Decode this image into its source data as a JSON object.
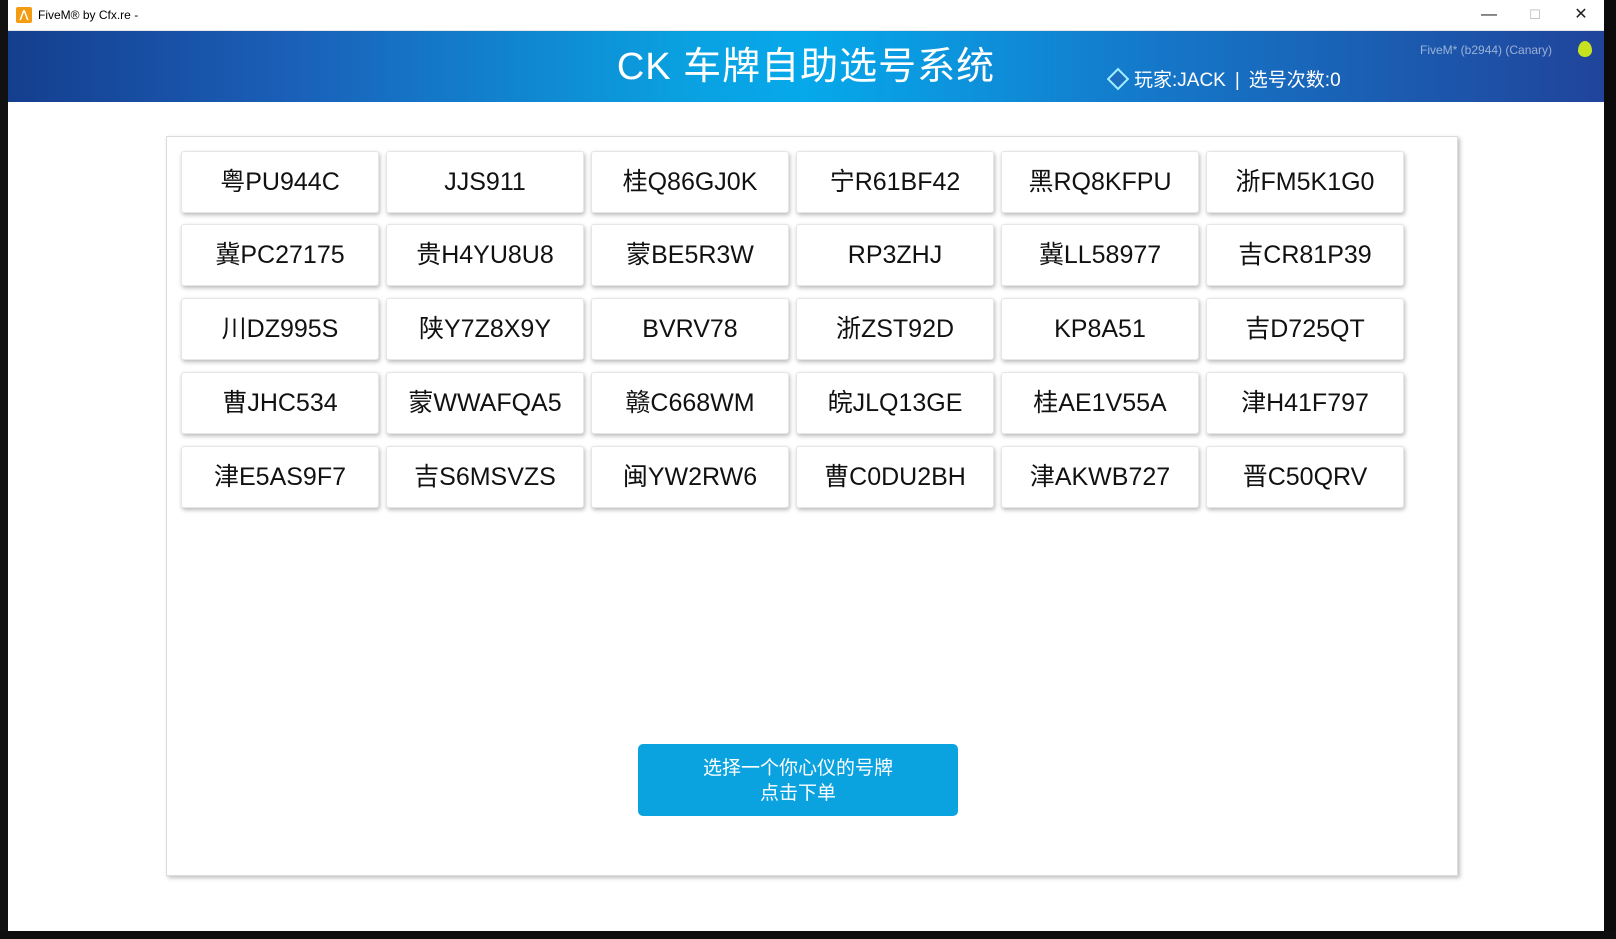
{
  "window": {
    "title": "FiveM® by Cfx.re -",
    "app_icon": "fivem-logo-icon",
    "controls": {
      "minimize": "—",
      "maximize": "☐",
      "close": "✕"
    }
  },
  "header": {
    "title": "CK 车牌自助选号系统",
    "version": "FiveM* (b2944) (Canary)",
    "player_label": "玩家:",
    "player_name": "JACK",
    "separator": "|",
    "count_label": "选号次数:",
    "count_value": "0"
  },
  "plates": [
    "粤PU944C",
    "JJS911",
    "桂Q86GJ0K",
    "宁R61BF42",
    "黑RQ8KFPU",
    "浙FM5K1G0",
    "冀PC27175",
    "贵H4YU8U8",
    "蒙BE5R3W",
    "RP3ZHJ",
    "冀LL58977",
    "吉CR81P39",
    "川DZ995S",
    "陕Y7Z8X9Y",
    "BVRV78",
    "浙ZST92D",
    "KP8A51",
    "吉D725QT",
    "曹JHC534",
    "蒙WWAFQA5",
    "赣C668WM",
    "皖JLQ13GE",
    "桂AE1V55A",
    "津H41F797",
    "津E5AS9F7",
    "吉S6MSVZS",
    "闽YW2RW6",
    "曹C0DU2BH",
    "津AKWB727",
    "晋C50QRV"
  ],
  "order_button": {
    "line1": "选择一个你心仪的号牌",
    "line2": "点击下单"
  }
}
